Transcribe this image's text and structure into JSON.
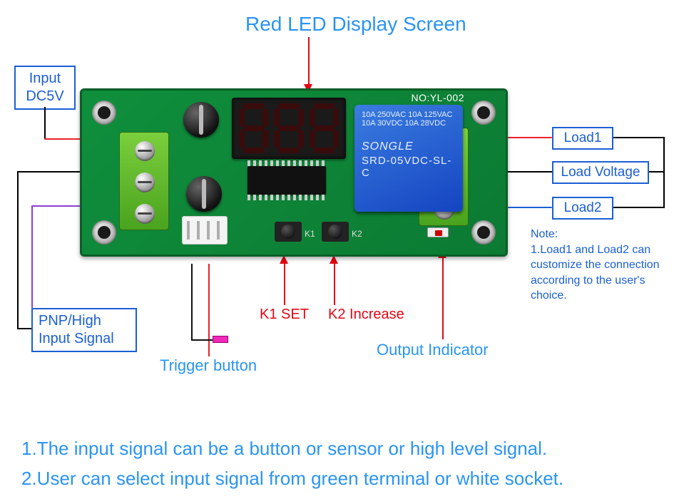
{
  "title_top": "Red LED Display Screen",
  "labels": {
    "input_dc5v_line1": "Input",
    "input_dc5v_line2": "DC5V",
    "pnp_line1": "PNP/High",
    "pnp_line2": "Input Signal",
    "load1": "Load1",
    "load_voltage": "Load Voltage",
    "load2": "Load2",
    "trigger": "Trigger button",
    "k1": "K1 SET",
    "k2": "K2 Increase",
    "output_indicator": "Output Indicator"
  },
  "note_title": "Note:",
  "note_body": "1.Load1 and Load2 can customize the connection according to the user's choice.",
  "board": {
    "model": "NO:YL-002",
    "relay_specs_l1": "10A 250VAC  10A 125VAC",
    "relay_specs_l2": "10A  30VDC   10A  28VDC",
    "relay_brand": "SONGLE",
    "relay_pn": "SRD-05VDC-SL-C",
    "k1_text": "K1",
    "k2_text": "K2"
  },
  "bottom": {
    "line1": "1.The input signal can be a button or sensor or high level signal.",
    "line2": "2.User can select input signal from green terminal or white socket."
  }
}
